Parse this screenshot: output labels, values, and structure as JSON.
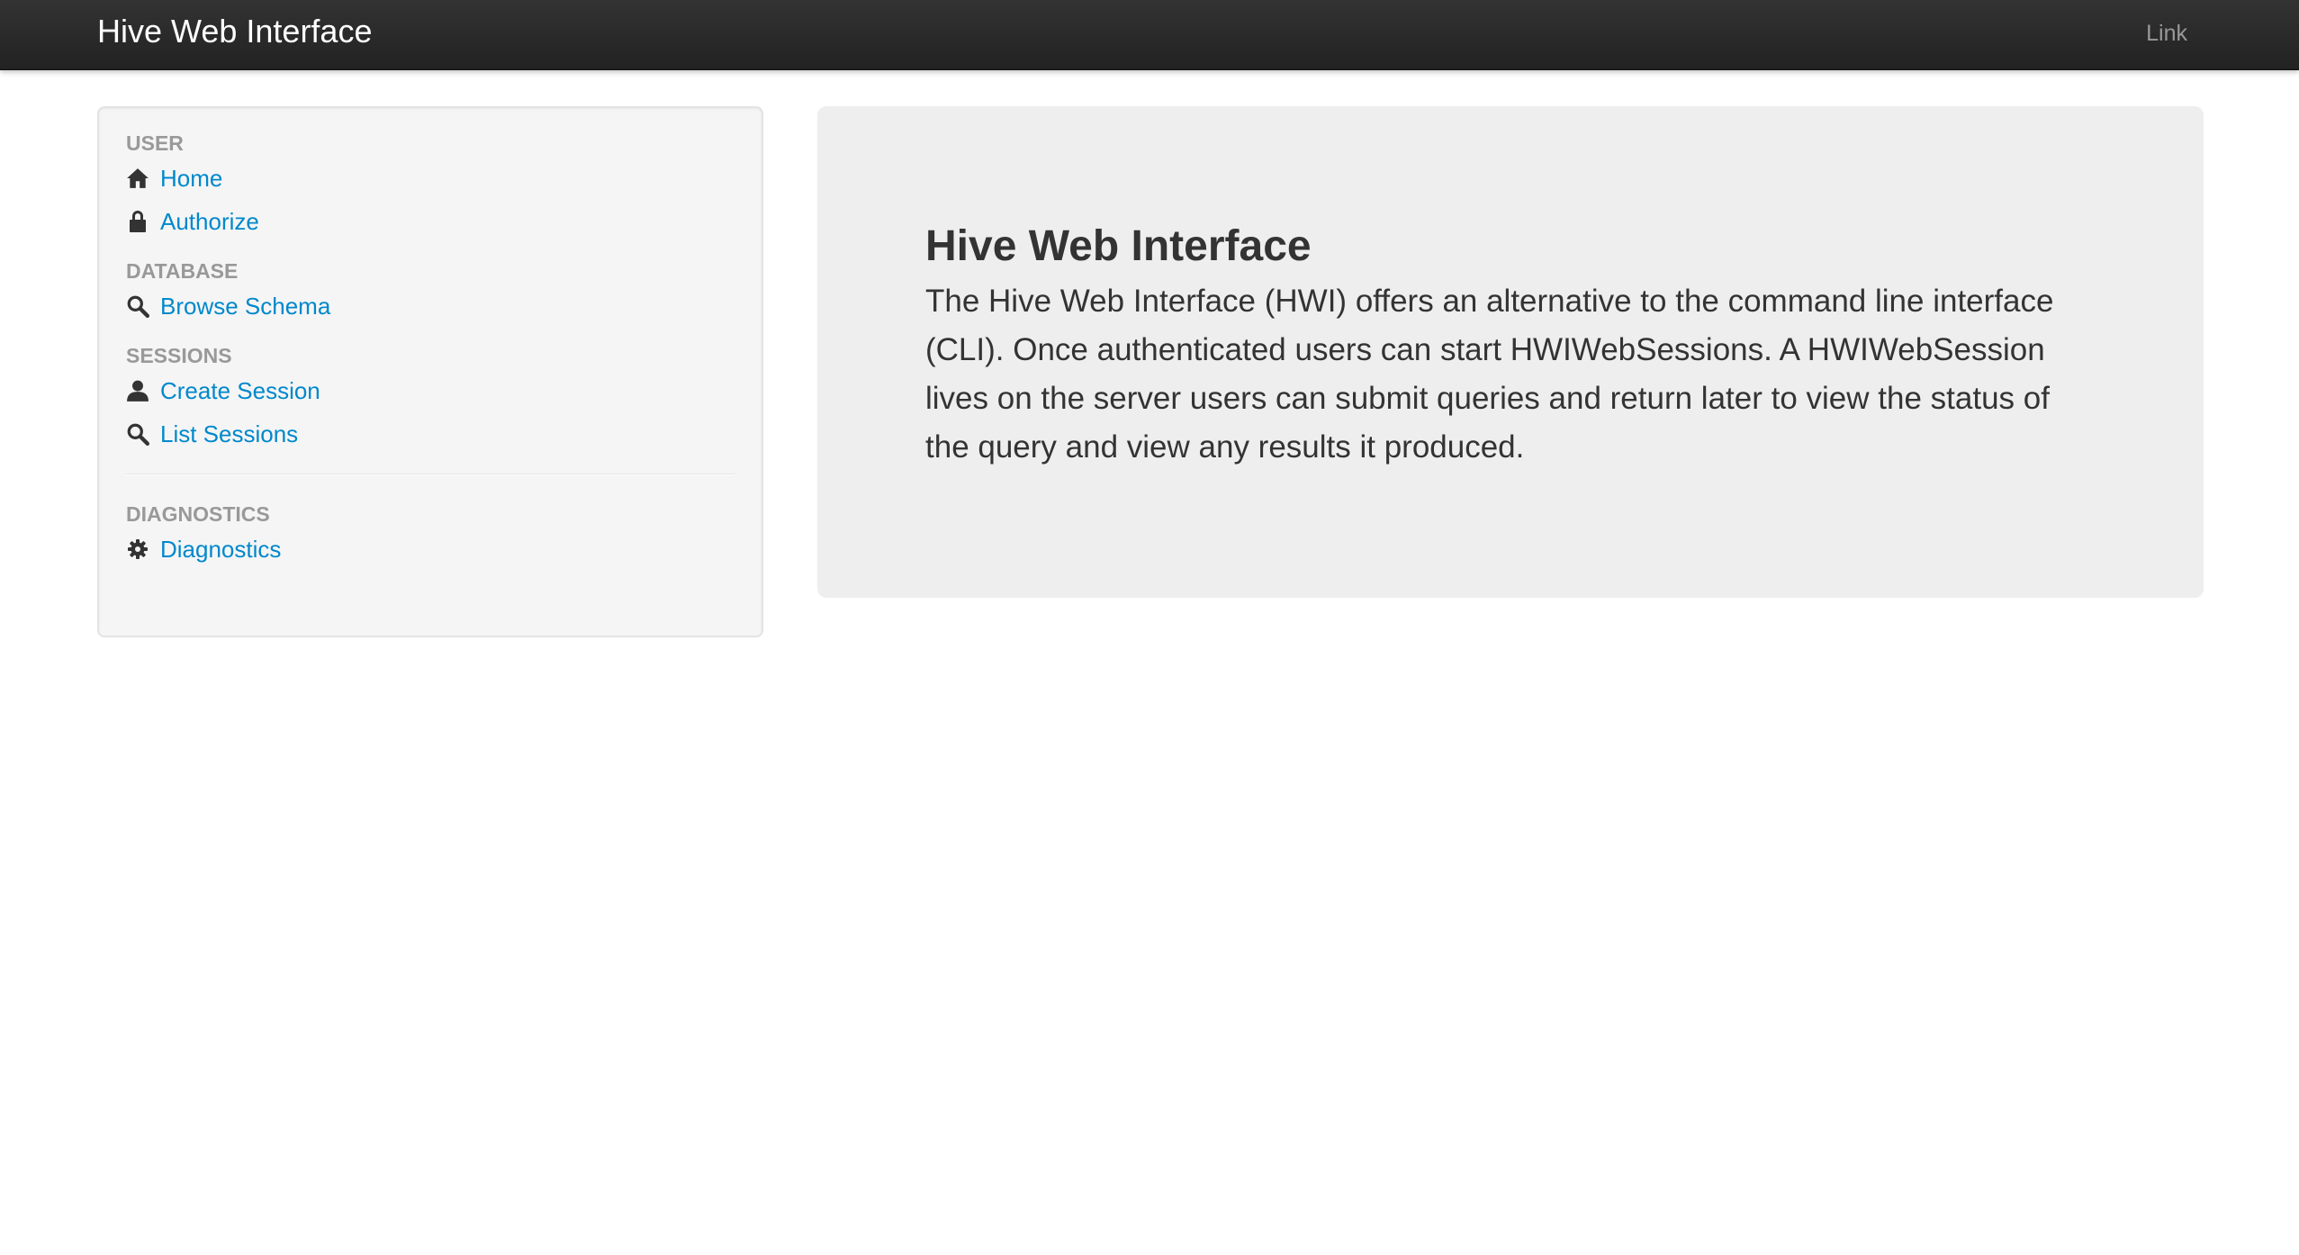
{
  "navbar": {
    "brand": "Hive Web Interface",
    "link": "Link"
  },
  "sidebar": {
    "sections": [
      {
        "header": "USER",
        "items": [
          {
            "label": "Home",
            "icon": "home-icon"
          },
          {
            "label": "Authorize",
            "icon": "lock-icon"
          }
        ]
      },
      {
        "header": "DATABASE",
        "items": [
          {
            "label": "Browse Schema",
            "icon": "search-icon"
          }
        ]
      },
      {
        "header": "SESSIONS",
        "items": [
          {
            "label": "Create Session",
            "icon": "user-icon"
          },
          {
            "label": "List Sessions",
            "icon": "search-icon"
          }
        ]
      },
      {
        "header": "DIAGNOSTICS",
        "items": [
          {
            "label": "Diagnostics",
            "icon": "cog-icon"
          }
        ]
      }
    ]
  },
  "hero": {
    "title": "Hive Web Interface",
    "body": "The Hive Web Interface (HWI) offers an alternative to the command line interface (CLI). Once authenticated users can start HWIWebSessions. A HWIWebSession lives on the server users can submit queries and return later to view the status of the query and view any results it produced."
  },
  "colors": {
    "navbar": "#222222",
    "link": "#0088cc",
    "header_text": "#999999",
    "hero_bg": "#eeeeee",
    "sidebar_bg": "#f5f5f5"
  }
}
